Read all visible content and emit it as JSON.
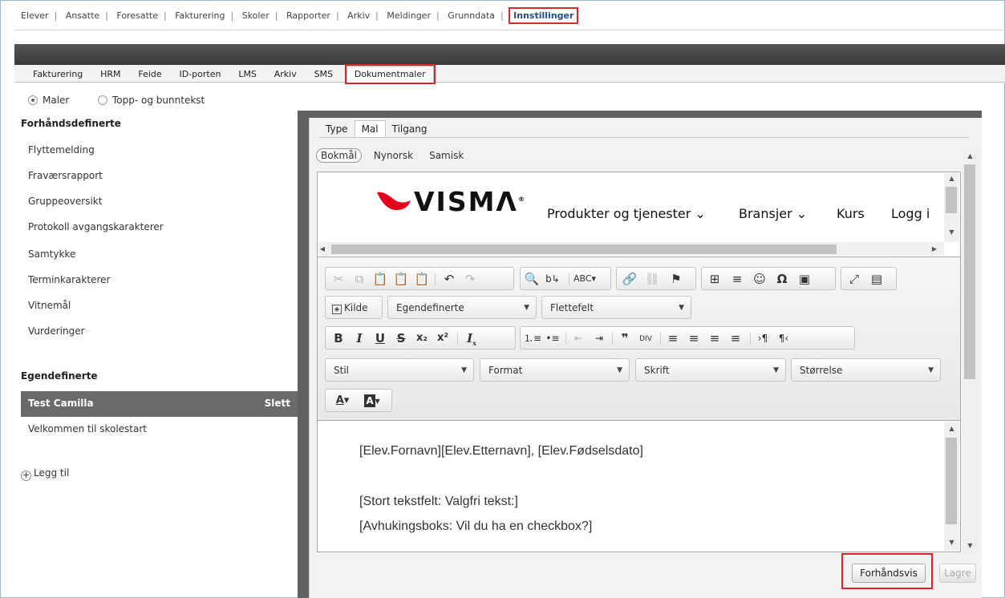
{
  "top_nav": {
    "items": [
      "Elever",
      "Ansatte",
      "Foresatte",
      "Fakturering",
      "Skoler",
      "Rapporter",
      "Arkiv",
      "Meldinger",
      "Grunndata"
    ],
    "active": "Innstillinger"
  },
  "sub_tabs": {
    "items": [
      "Fakturering",
      "HRM",
      "Feide",
      "ID-porten",
      "LMS",
      "Arkiv",
      "SMS"
    ],
    "active": "Dokumentmaler"
  },
  "radios": {
    "maler": "Maler",
    "topp_bunn": "Topp- og bunntekst",
    "selected": "Maler"
  },
  "predefined": {
    "heading": "Forhåndsdefinerte",
    "items": [
      "Flyttemelding",
      "Fraværsrapport",
      "Gruppeoversikt",
      "Protokoll avgangskarakterer",
      "Samtykke",
      "Terminkarakterer",
      "Vitnemål",
      "Vurderinger"
    ]
  },
  "custom": {
    "heading": "Egendefinerte",
    "selected": "Test Camilla",
    "delete_label": "Slett",
    "items": [
      "Velkommen til skolestart"
    ],
    "add_label": "Legg til"
  },
  "editor_tabs": {
    "items": [
      "Type",
      "Mal",
      "Tilgang"
    ],
    "active": "Mal"
  },
  "languages": {
    "items": [
      "Bokmål",
      "Nynorsk",
      "Samisk"
    ],
    "active": "Bokmål"
  },
  "header_preview": {
    "logo_text": "VISMA",
    "nav": [
      "Produkter og tjenester ⌄",
      "Bransjer ⌄",
      "Kurs",
      "Logg i"
    ]
  },
  "toolbar": {
    "source_label": "Kilde",
    "style_combo": "Egendefinerte",
    "merge_combo": "Flettefelt",
    "stil": "Stil",
    "format": "Format",
    "skrift": "Skrift",
    "storrelse": "Størrelse"
  },
  "content_lines": [
    "[Elev.Fornavn][Elev.Etternavn], [Elev.Fødselsdato]",
    "[Stort tekstfelt: Valgfri tekst:]",
    "[Avhukingsboks: Vil du ha en checkbox?]"
  ],
  "buttons": {
    "preview": "Forhåndsvis",
    "save": "Lagre"
  },
  "colors": {
    "highlight": "#d9272e",
    "visma_red": "#e2001a",
    "selected_row": "#6a6a6a"
  }
}
